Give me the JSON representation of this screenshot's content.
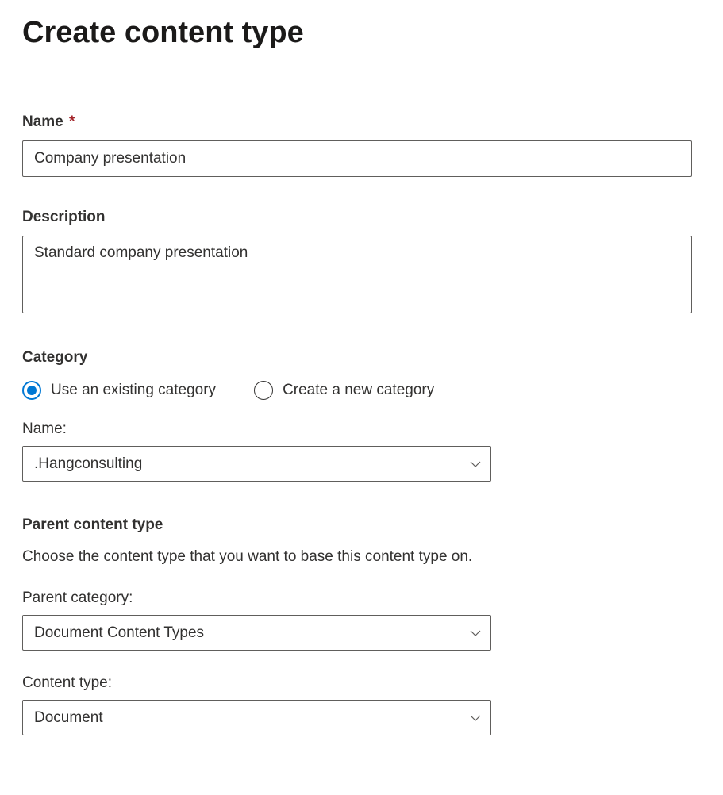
{
  "page": {
    "title": "Create content type"
  },
  "fields": {
    "name": {
      "label": "Name",
      "required_mark": "*",
      "value": "Company presentation"
    },
    "description": {
      "label": "Description",
      "value": "Standard company presentation"
    }
  },
  "category": {
    "heading": "Category",
    "options": {
      "existing": "Use an existing category",
      "new": "Create a new category"
    },
    "name_label": "Name:",
    "name_value": ".Hangconsulting"
  },
  "parent": {
    "heading": "Parent content type",
    "helper": "Choose the content type that you want to base this content type on.",
    "category_label": "Parent category:",
    "category_value": "Document Content Types",
    "type_label": "Content type:",
    "type_value": "Document"
  }
}
